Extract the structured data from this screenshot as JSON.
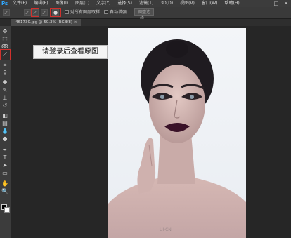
{
  "app": {
    "logo": "Ps"
  },
  "menu": [
    "文件(F)",
    "编辑(E)",
    "图像(I)",
    "图层(L)",
    "文字(Y)",
    "选择(S)",
    "滤镜(T)",
    "3D(D)",
    "视图(V)",
    "窗口(W)",
    "帮助(H)"
  ],
  "window_controls": {
    "minimize": "–",
    "maximize": "□",
    "close": "✕"
  },
  "options": {
    "sample_all_layers": "对所有图层取样",
    "auto_enhance": "自动增强",
    "refine_edge": "调整边缘..."
  },
  "document_tab": {
    "label": "461730.jpg @ 50.3% (RGB/8) ×"
  },
  "tooltip": {
    "text": "请登录后查看原图"
  },
  "watermark": "UI·CN",
  "icons": {
    "tools": [
      "move-icon",
      "marquee-icon",
      "lasso-icon",
      "quick-selection-icon",
      "crop-icon",
      "eyedropper-icon",
      "healing-icon",
      "brush-icon",
      "clone-stamp-icon",
      "history-brush-icon",
      "eraser-icon",
      "gradient-icon",
      "blur-icon",
      "dodge-icon",
      "pen-icon",
      "type-icon",
      "path-selection-icon",
      "rectangle-icon",
      "hand-icon",
      "zoom-icon"
    ]
  }
}
